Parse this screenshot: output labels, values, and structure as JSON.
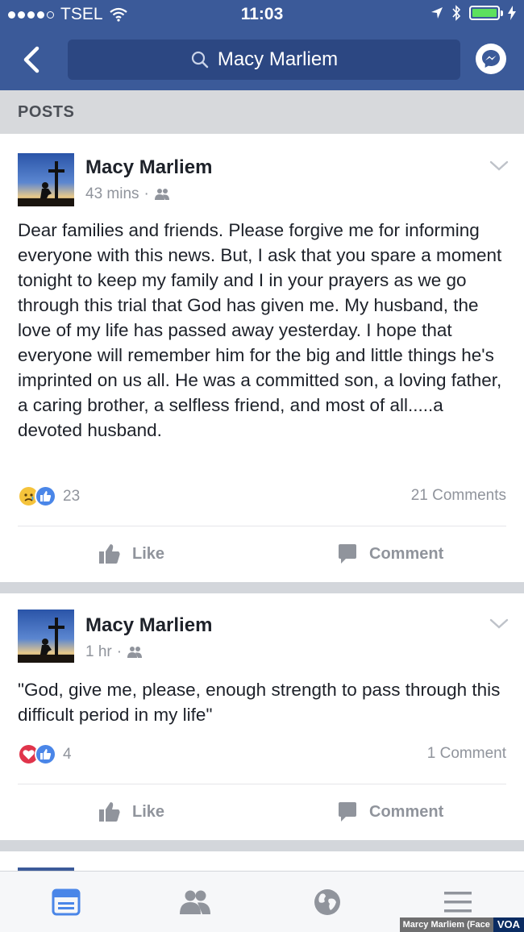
{
  "status_bar": {
    "carrier": "TSEL",
    "time": "11:03"
  },
  "nav": {
    "search_text": "Macy Marliem"
  },
  "section_title": "POSTS",
  "posts": [
    {
      "author": "Macy Marliem",
      "time": "43 mins",
      "separator": "·",
      "text": "Dear families and friends. Please forgive me for informing everyone with this news. But, I ask that you spare a moment tonight to keep my family and I in your prayers as we go through this trial that God has given me. My husband, the love of my life has passed away yesterday. I hope that everyone will remember him for the big and little things he's imprinted on us all. He was a committed son, a loving father, a caring brother, a selfless friend, and most of all.....a devoted husband.",
      "reaction_count": "23",
      "reactions": [
        "sad",
        "like"
      ],
      "comments": "21 Comments",
      "like_label": "Like",
      "comment_label": "Comment"
    },
    {
      "author": "Macy Marliem",
      "time": "1 hr",
      "separator": "·",
      "text": "\"God, give me, please, enough strength to pass through this difficult period in my life\"",
      "reaction_count": "4",
      "reactions": [
        "love",
        "like"
      ],
      "comments": "1 Comment",
      "like_label": "Like",
      "comment_label": "Comment"
    }
  ],
  "tabbar": {
    "icons": [
      "news-feed-icon",
      "friends-icon",
      "globe-icon",
      "menu-icon"
    ]
  },
  "watermark": {
    "source": "Marcy Marliem (Face",
    "brand": "VOA"
  },
  "colors": {
    "brand": "#3b5a99",
    "like_blue": "#4a86e8",
    "love_red": "#e0344b",
    "sad_yellow": "#f5c33b"
  }
}
